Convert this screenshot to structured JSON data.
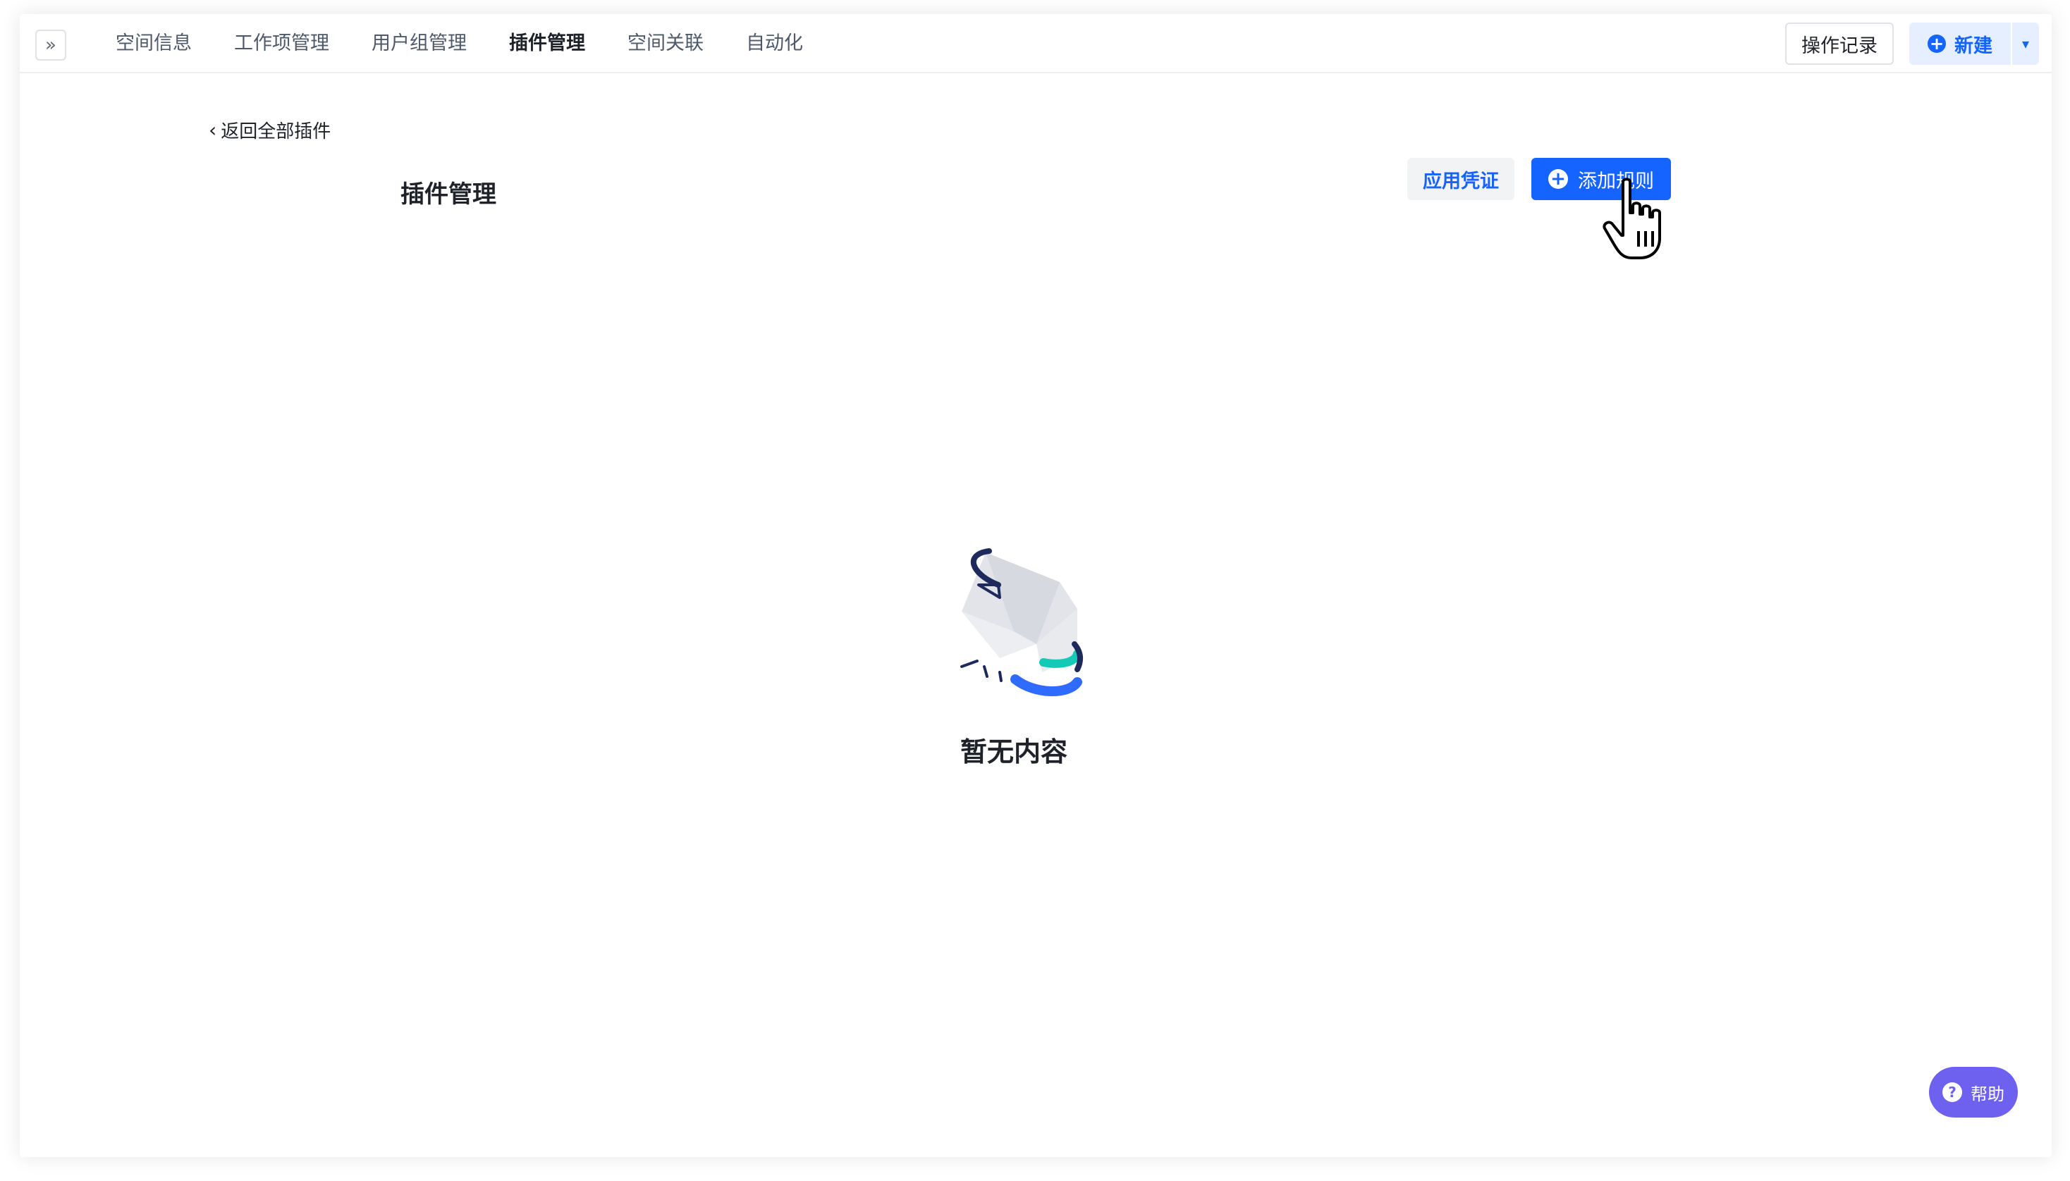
{
  "topbar": {
    "expand_icon": "»",
    "tabs": [
      {
        "label": "空间信息",
        "active": false
      },
      {
        "label": "工作项管理",
        "active": false
      },
      {
        "label": "用户组管理",
        "active": false
      },
      {
        "label": "插件管理",
        "active": true
      },
      {
        "label": "空间关联",
        "active": false
      },
      {
        "label": "自动化",
        "active": false
      }
    ],
    "log_label": "操作记录",
    "new_label": "新建",
    "new_plus": "+",
    "new_dropdown": "▾"
  },
  "main": {
    "back_chevron": "‹",
    "back_label": "返回全部插件",
    "title": "插件管理",
    "credential_label": "应用凭证",
    "add_rule_plus": "+",
    "add_rule_label": "添加规则",
    "empty_text": "暂无内容"
  },
  "help": {
    "icon": "?",
    "label": "帮助"
  },
  "colors": {
    "primary": "#1664ff",
    "help": "#6f61f0",
    "teal": "#14c9b6",
    "navy": "#1f2a5c"
  }
}
